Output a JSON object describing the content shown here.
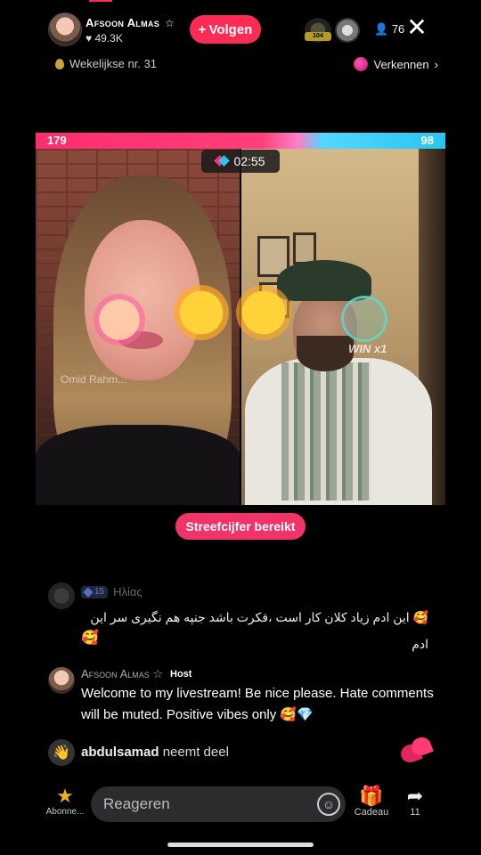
{
  "header": {
    "host_name": "Afsoon Almas",
    "host_star": "☆",
    "likes": "49.3K",
    "follow_label": "Volgen",
    "viewer_count": "76",
    "viewer_badge": "104",
    "close_icon": "close-icon"
  },
  "subbar": {
    "weekly_label": "Wekelijkse nr. 31",
    "explore_label": "Verkennen"
  },
  "battle": {
    "score_left": "179",
    "score_right": "98",
    "timer": "02:55",
    "left_watermark": "Omid Rahm...",
    "right_label": "WIN x1",
    "goal_label": "Streefcijfer bereikt",
    "colors": {
      "left": "#ff2d6e",
      "right": "#2ac4f0"
    }
  },
  "comments": [
    {
      "level": "15",
      "user": "Ηλίας",
      "text": "🥰 این ادم زیاد کلان کار است ،فکرت باشد جنپه هم نگیری سر این ادم",
      "text_cont": "🥰"
    },
    {
      "user": "Afsoon Almas ☆",
      "tag": "Host",
      "text": "Welcome to my livestream! Be nice please. Hate comments will be muted. Positive vibes only 🥰💎"
    },
    {
      "user": "abdulsamad",
      "action": "neemt deel"
    }
  ],
  "bottom": {
    "favorites_label": "Abonne...",
    "input_placeholder": "Reageren",
    "gift_label": "Cadeau",
    "share_count": "11"
  }
}
